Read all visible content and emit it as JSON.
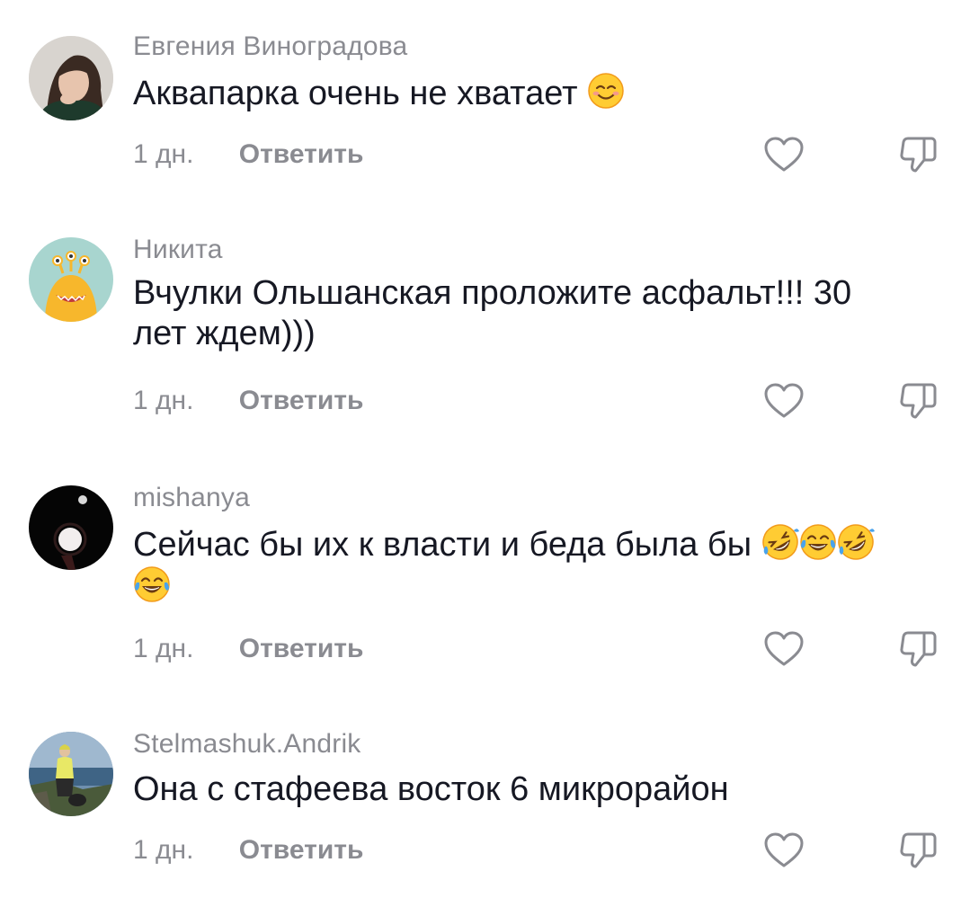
{
  "comments": [
    {
      "author": "Евгения Виноградова",
      "text": "Аквапарка очень не хватает",
      "emojis": [
        "smiling-face-with-smiling-eyes"
      ],
      "age": "1 дн.",
      "reply_label": "Ответить"
    },
    {
      "author": "Никита",
      "text_line1": "Вчулки Ольшанская проложите асфальт!!! 30",
      "text_line2": "лет ждем)))",
      "age": "1 дн.",
      "reply_label": "Ответить"
    },
    {
      "author": "mishanya",
      "text": "Сейчас бы их к власти и беда была бы",
      "emojis": [
        "rolling-on-the-floor-laughing",
        "face-with-tears-of-joy",
        "rolling-on-the-floor-laughing",
        "face-with-tears-of-joy"
      ],
      "age": "1 дн.",
      "reply_label": "Ответить"
    },
    {
      "author": "Stelmashuk.Andrik",
      "text": "Она с стафеева восток 6 микрорайон",
      "age": "1 дн.",
      "reply_label": "Ответить"
    }
  ],
  "icons": {
    "like": "heart-outline-icon",
    "dislike": "thumbs-down-outline-icon"
  },
  "colors": {
    "secondary_text": "#8a8b91",
    "primary_text": "#161823"
  }
}
